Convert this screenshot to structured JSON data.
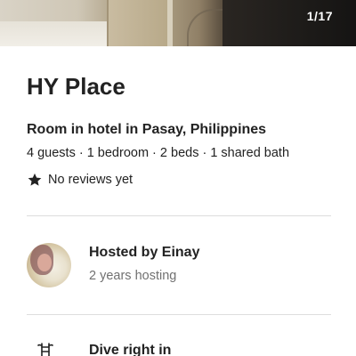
{
  "photo": {
    "counter": "1/17"
  },
  "listing": {
    "title": "HY Place",
    "subtitle": "Room in hotel in Pasay, Philippines",
    "details": "4 guests · 1 bedroom · 2 beds · 1 shared bath",
    "reviews": "No reviews yet",
    "review_icon": "star-icon"
  },
  "host": {
    "name": "Hosted by Einay",
    "duration": "2 years hosting",
    "avatar_icon": "avatar"
  },
  "features": [
    {
      "icon": "pool-ladder-icon",
      "title": "Dive right in"
    }
  ],
  "colors": {
    "text_primary": "#222222",
    "text_secondary": "#717171",
    "divider": "#dddddd"
  }
}
